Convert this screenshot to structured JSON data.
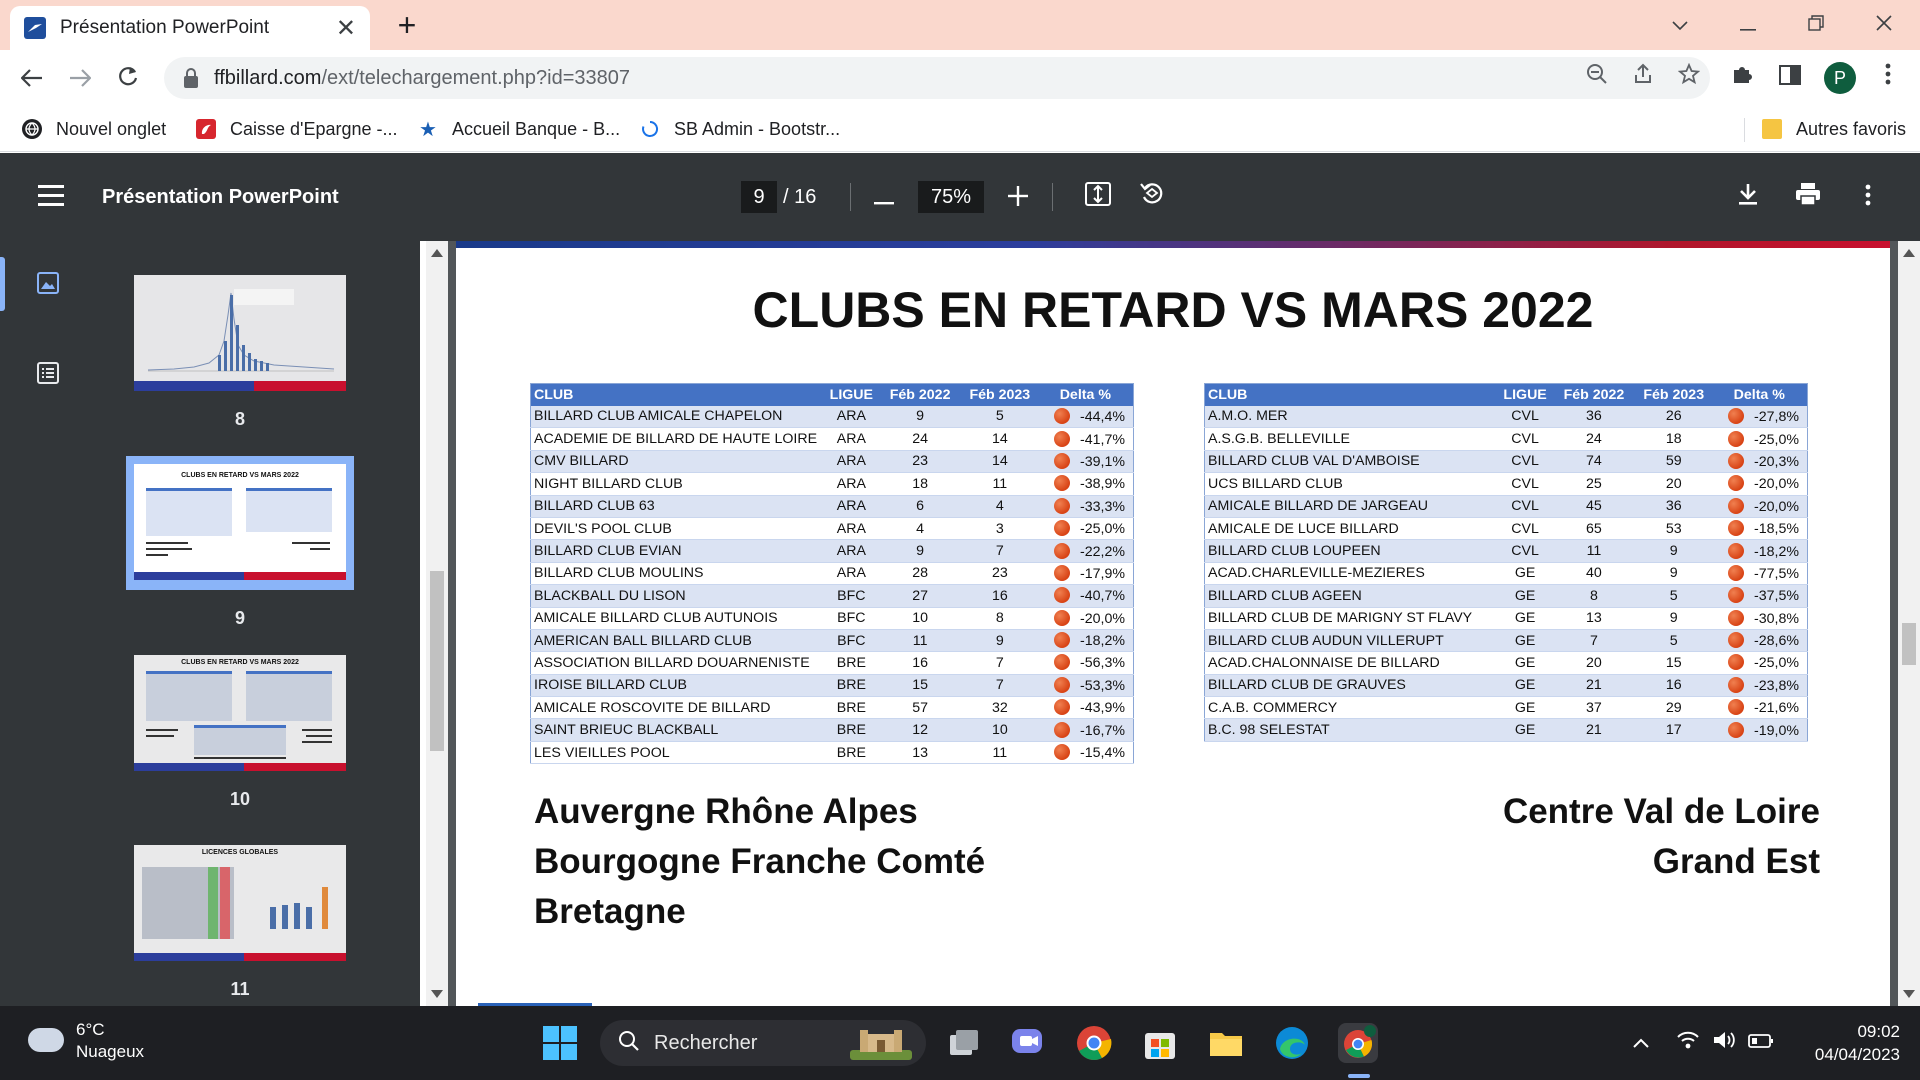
{
  "browser": {
    "tab_title": "Présentation PowerPoint",
    "url_host": "ffbillard.com",
    "url_path": "/ext/telechargement.php?id=33807",
    "profile_initial": "P",
    "bookmarks": [
      "Nouvel onglet",
      "Caisse d'Epargne -...",
      "Accueil Banque - B...",
      "SB Admin - Bootstr..."
    ],
    "other_bookmarks": "Autres favoris"
  },
  "pdf": {
    "title": "Présentation PowerPoint",
    "page_current": "9",
    "page_total": "/ 16",
    "zoom": "75%",
    "thumbnails": [
      {
        "num": "8"
      },
      {
        "num": "9",
        "title": "CLUBS EN RETARD VS MARS 2022"
      },
      {
        "num": "10",
        "title": "CLUBS EN RETARD VS MARS 2022"
      },
      {
        "num": "11",
        "title": "LICENCES GLOBALES"
      }
    ]
  },
  "slide": {
    "title": "CLUBS EN RETARD VS MARS 2022",
    "headers": [
      "CLUB",
      "LIGUE",
      "Féb 2022",
      "Féb 2023",
      "Delta %"
    ],
    "left_rows": [
      [
        "BILLARD CLUB AMICALE CHAPELON",
        "ARA",
        "9",
        "5",
        "-44,4%"
      ],
      [
        "ACADEMIE DE BILLARD DE HAUTE LOIRE",
        "ARA",
        "24",
        "14",
        "-41,7%"
      ],
      [
        "CMV BILLARD",
        "ARA",
        "23",
        "14",
        "-39,1%"
      ],
      [
        "NIGHT BILLARD CLUB",
        "ARA",
        "18",
        "11",
        "-38,9%"
      ],
      [
        "BILLARD CLUB 63",
        "ARA",
        "6",
        "4",
        "-33,3%"
      ],
      [
        "DEVIL'S POOL CLUB",
        "ARA",
        "4",
        "3",
        "-25,0%"
      ],
      [
        "BILLARD CLUB EVIAN",
        "ARA",
        "9",
        "7",
        "-22,2%"
      ],
      [
        "BILLARD CLUB MOULINS",
        "ARA",
        "28",
        "23",
        "-17,9%"
      ],
      [
        "BLACKBALL DU LISON",
        "BFC",
        "27",
        "16",
        "-40,7%"
      ],
      [
        "AMICALE BILLARD CLUB AUTUNOIS",
        "BFC",
        "10",
        "8",
        "-20,0%"
      ],
      [
        "AMERICAN BALL BILLARD CLUB",
        "BFC",
        "11",
        "9",
        "-18,2%"
      ],
      [
        "ASSOCIATION BILLARD DOUARNENISTE",
        "BRE",
        "16",
        "7",
        "-56,3%"
      ],
      [
        "IROISE BILLARD CLUB",
        "BRE",
        "15",
        "7",
        "-53,3%"
      ],
      [
        "AMICALE ROSCOVITE DE BILLARD",
        "BRE",
        "57",
        "32",
        "-43,9%"
      ],
      [
        "SAINT BRIEUC BLACKBALL",
        "BRE",
        "12",
        "10",
        "-16,7%"
      ],
      [
        "LES VIEILLES POOL",
        "BRE",
        "13",
        "11",
        "-15,4%"
      ]
    ],
    "right_rows": [
      [
        "A.M.O. MER",
        "CVL",
        "36",
        "26",
        "-27,8%"
      ],
      [
        "A.S.G.B. BELLEVILLE",
        "CVL",
        "24",
        "18",
        "-25,0%"
      ],
      [
        "BILLARD CLUB VAL D'AMBOISE",
        "CVL",
        "74",
        "59",
        "-20,3%"
      ],
      [
        "UCS BILLARD CLUB",
        "CVL",
        "25",
        "20",
        "-20,0%"
      ],
      [
        "AMICALE BILLARD DE JARGEAU",
        "CVL",
        "45",
        "36",
        "-20,0%"
      ],
      [
        "AMICALE DE LUCE BILLARD",
        "CVL",
        "65",
        "53",
        "-18,5%"
      ],
      [
        "BILLARD CLUB LOUPEEN",
        "CVL",
        "11",
        "9",
        "-18,2%"
      ],
      [
        "ACAD.CHARLEVILLE-MEZIERES",
        "GE",
        "40",
        "9",
        "-77,5%"
      ],
      [
        "BILLARD CLUB AGEEN",
        "GE",
        "8",
        "5",
        "-37,5%"
      ],
      [
        "BILLARD CLUB DE MARIGNY ST FLAVY",
        "GE",
        "13",
        "9",
        "-30,8%"
      ],
      [
        "BILLARD CLUB AUDUN VILLERUPT",
        "GE",
        "7",
        "5",
        "-28,6%"
      ],
      [
        "ACAD.CHALONNAISE DE BILLARD",
        "GE",
        "20",
        "15",
        "-25,0%"
      ],
      [
        "BILLARD CLUB DE GRAUVES",
        "GE",
        "21",
        "16",
        "-23,8%"
      ],
      [
        "C.A.B. COMMERCY",
        "GE",
        "37",
        "29",
        "-21,6%"
      ],
      [
        "B.C. 98 SELESTAT",
        "GE",
        "21",
        "17",
        "-19,0%"
      ]
    ],
    "regions_left": [
      "Auvergne Rhône Alpes",
      "Bourgogne Franche Comté",
      "Bretagne"
    ],
    "regions_right": [
      "Centre Val de Loire",
      "Grand Est"
    ]
  },
  "taskbar": {
    "weather_temp": "6°C",
    "weather_desc": "Nuageux",
    "search_label": "Rechercher",
    "time": "09:02",
    "date": "04/04/2023"
  },
  "colors": {
    "tab_strip": "#fad8cd",
    "viewer_bg": "#323639",
    "table_header": "#4472c4",
    "delta_dot": "#d84315"
  }
}
